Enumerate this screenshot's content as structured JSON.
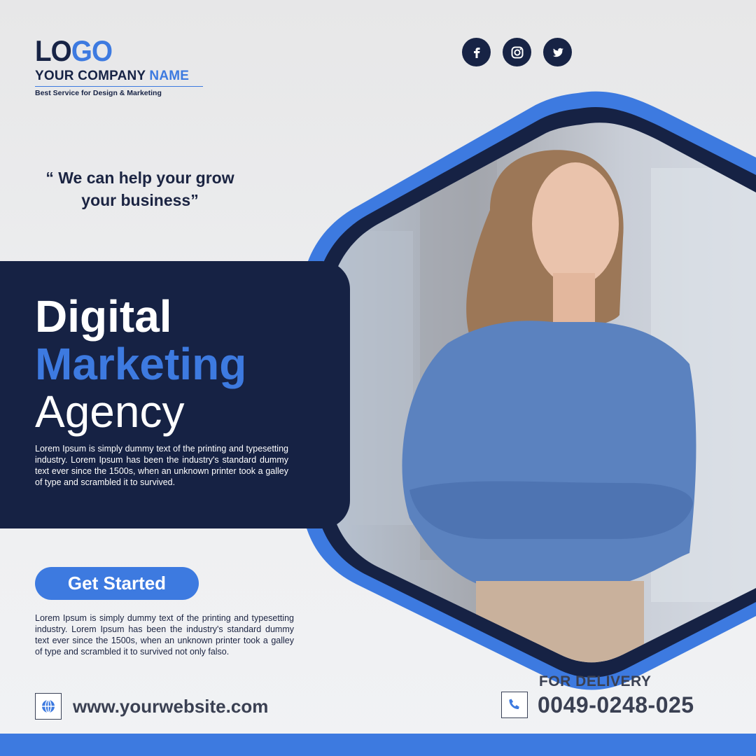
{
  "brand": {
    "logo_part1": "LO",
    "logo_part2": "GO",
    "company_part1": "YOUR COMPANY",
    "company_part2": "NAME",
    "tagline": "Best Service for Design & Marketing"
  },
  "social": [
    "facebook-icon",
    "instagram-icon",
    "twitter-icon"
  ],
  "quote": "“ We can help your grow your business”",
  "headline": {
    "line1": "Digital",
    "line2": "Marketing",
    "line3": "Agency"
  },
  "description_1": "Lorem Ipsum is simply dummy text of the printing and typesetting industry. Lorem Ipsum has been the industry's standard dummy text ever since the 1500s, when an unknown printer took a galley of type and scrambled it to  survived.",
  "cta_label": "Get Started",
  "description_2": "Lorem Ipsum is simply dummy text of the printing and typesetting industry. Lorem Ipsum has been the industry's standard dummy text ever since the 1500s, when an unknown printer took a galley of type and scrambled it to  survived not only falso.",
  "website": "www.yourwebsite.com",
  "delivery": {
    "label": "FOR DELIVERY",
    "phone": "0049-0248-025"
  },
  "colors": {
    "navy": "#162244",
    "accent_blue": "#3d7ae0",
    "background": "#ebebec",
    "text_gray": "#3a4052"
  }
}
